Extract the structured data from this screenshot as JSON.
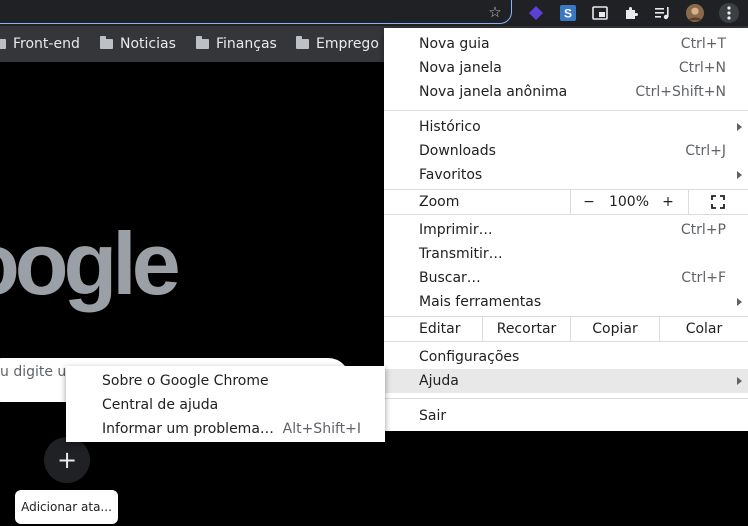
{
  "bookmarks": {
    "items": [
      {
        "label": "Front-end"
      },
      {
        "label": "Noticias"
      },
      {
        "label": "Finanças"
      },
      {
        "label": "Emprego"
      }
    ]
  },
  "page": {
    "logo_text": "oogle",
    "search_placeholder": "u digite um",
    "shortcut_add_symbol": "+",
    "shortcut_label": "Adicionar ata..."
  },
  "menu": {
    "new_tab": {
      "label": "Nova guia",
      "shortcut": "Ctrl+T"
    },
    "new_window": {
      "label": "Nova janela",
      "shortcut": "Ctrl+N"
    },
    "incognito": {
      "label": "Nova janela anônima",
      "shortcut": "Ctrl+Shift+N"
    },
    "history": {
      "label": "Histórico"
    },
    "downloads": {
      "label": "Downloads",
      "shortcut": "Ctrl+J"
    },
    "bookmarks": {
      "label": "Favoritos"
    },
    "zoom": {
      "label": "Zoom",
      "minus": "−",
      "value": "100%",
      "plus": "+"
    },
    "print": {
      "label": "Imprimir…",
      "shortcut": "Ctrl+P"
    },
    "cast": {
      "label": "Transmitir…"
    },
    "find": {
      "label": "Buscar…",
      "shortcut": "Ctrl+F"
    },
    "more_tools": {
      "label": "Mais ferramentas"
    },
    "edit": {
      "label": "Editar",
      "cut": "Recortar",
      "copy": "Copiar",
      "paste": "Colar"
    },
    "settings": {
      "label": "Configurações"
    },
    "help": {
      "label": "Ajuda"
    },
    "exit": {
      "label": "Sair"
    }
  },
  "help_submenu": {
    "about": {
      "label": "Sobre o Google Chrome"
    },
    "help_center": {
      "label": "Central de ajuda"
    },
    "report": {
      "label": "Informar um problema…",
      "shortcut": "Alt+Shift+I"
    }
  },
  "colors": {
    "accent": "#8ab4f8",
    "highlight": "#e8e8e9",
    "toolbar": "#202124",
    "bookmarks_bar": "#35363a"
  }
}
